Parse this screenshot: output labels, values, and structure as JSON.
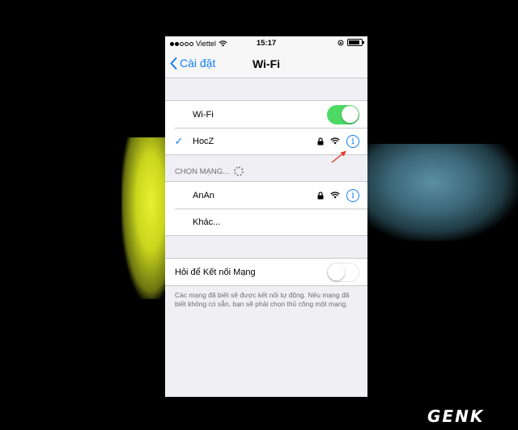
{
  "status_bar": {
    "carrier": "Viettel",
    "time": "15:17"
  },
  "nav": {
    "back_label": "Cài đặt",
    "title": "Wi-Fi"
  },
  "wifi_row": {
    "label": "Wi-Fi",
    "enabled": true
  },
  "connected_network": {
    "name": "HocZ",
    "secured": true
  },
  "choose_network": {
    "header": "CHỌN MẠNG..."
  },
  "networks": [
    {
      "name": "AnAn",
      "secured": true
    }
  ],
  "other_label": "Khác...",
  "ask_to_join": {
    "label": "Hỏi để Kết nối Mạng",
    "enabled": false,
    "footer": "Các mạng đã biết sẽ được kết nối tự động. Nếu mạng đã biết không có sẵn, bạn sẽ phải chọn thủ công một mạng."
  },
  "watermark": "GENK",
  "colors": {
    "accent": "#147efb",
    "toggle_on": "#4cd964",
    "annotation_arrow": "#e53935"
  }
}
